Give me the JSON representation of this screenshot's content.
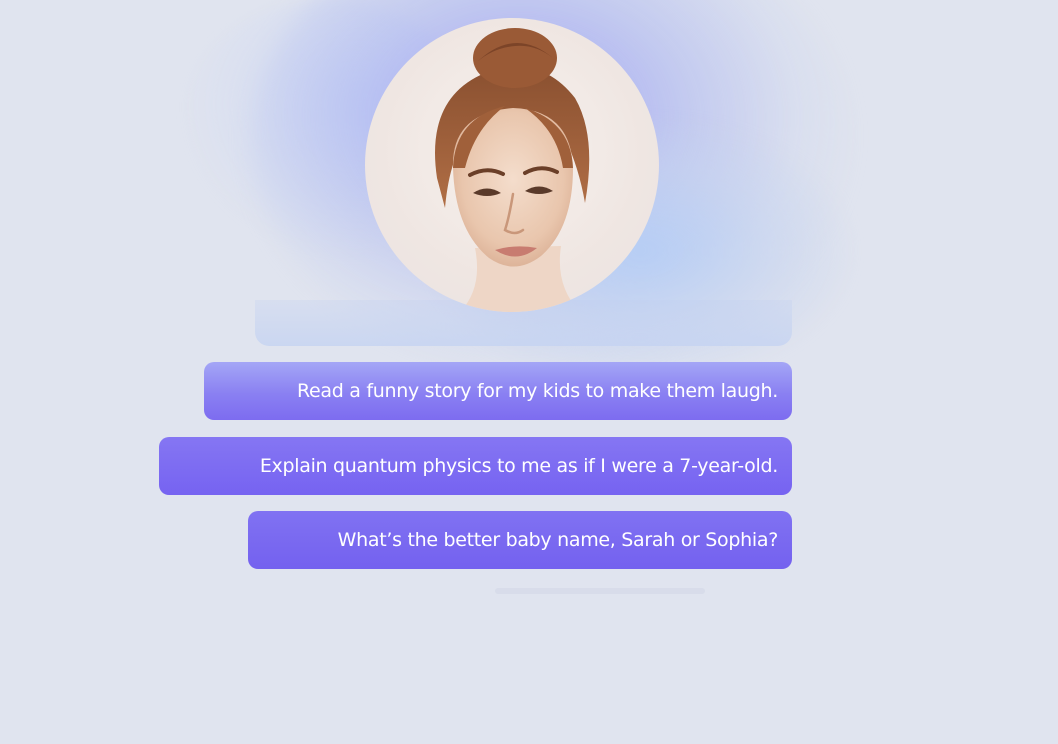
{
  "avatar": {
    "alt": "Assistant avatar portrait"
  },
  "prompts": [
    {
      "label": "Read a funny story for my kids to make them laugh."
    },
    {
      "label": "Explain quantum physics to me as if I were a 7-year-old."
    },
    {
      "label": "What’s the better baby name, Sarah or Sophia?"
    }
  ],
  "colors": {
    "background": "#e0e4ef",
    "prompt_accent": "#7663f1",
    "glow": "#9a96f2"
  }
}
